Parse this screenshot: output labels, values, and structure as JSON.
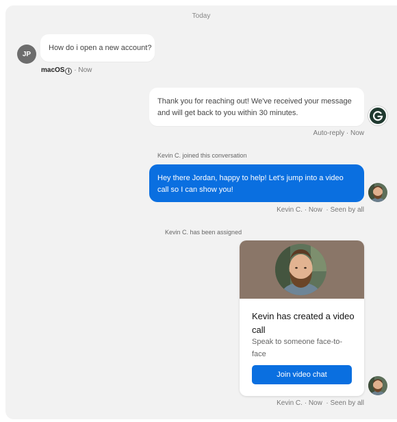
{
  "divider": {
    "label": "Today"
  },
  "messages": {
    "customer": {
      "initials": "JP",
      "text": "How do i open a new account?",
      "platform": "macOS",
      "separator": "·",
      "time": "Now"
    },
    "auto_reply": {
      "text": "Thank you for reaching out! We've received your message and will get back to you within 30 minutes.",
      "meta": "Auto-reply · Now",
      "avatar_letter": "G"
    },
    "joined_note": "Kevin C. joined this conversation",
    "agent_reply": {
      "text": "Hey there Jordan, happy to help! Let's jump into a video call so I can show you!",
      "sender": "Kevin C.",
      "time": "Now",
      "seen": "Seen by all"
    },
    "assigned_note": "Kevin C. has been assigned",
    "video_card": {
      "title": "Kevin has created a video call",
      "subtitle": "Speak to someone face-to-face",
      "button_label": "Join video chat",
      "sender": "Kevin C.",
      "time": "Now",
      "seen": "Seen by all"
    }
  },
  "colors": {
    "panel_background": "#f2f2f2",
    "primary_blue": "#0a6fe0",
    "customer_avatar": "#6d6d6d",
    "brand_avatar": "#203a30",
    "card_header": "#8a7668"
  },
  "icons": {
    "info": "info-circle-icon",
    "brand": "g-logo-icon"
  }
}
